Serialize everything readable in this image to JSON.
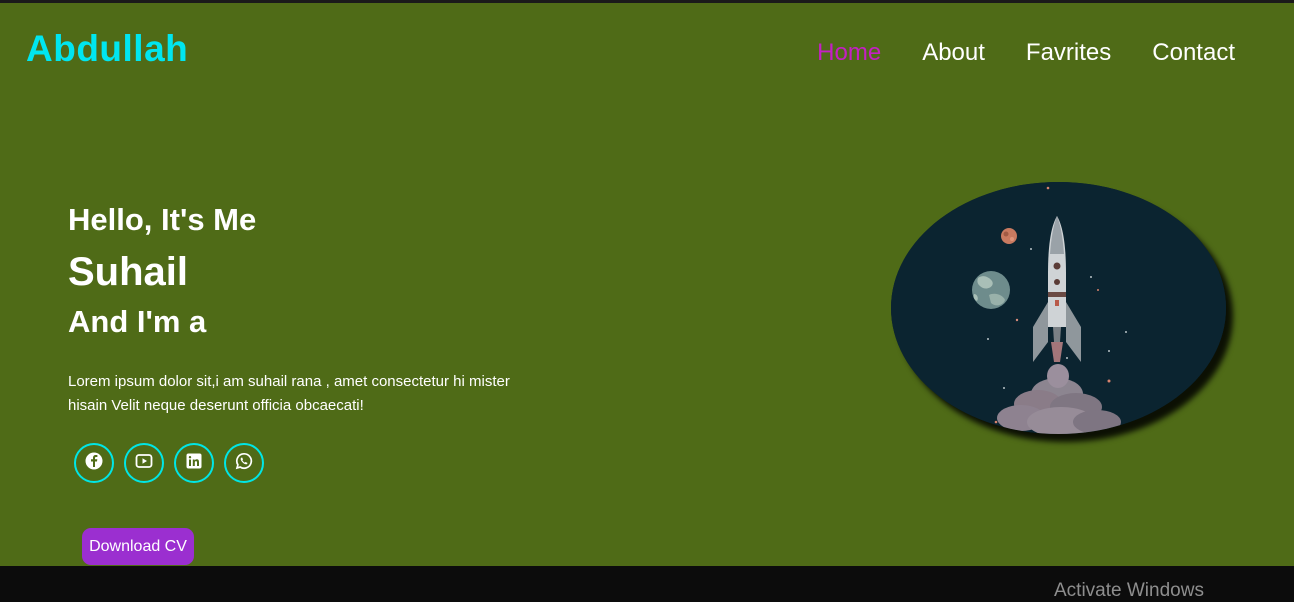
{
  "header": {
    "logo": "Abdullah",
    "nav": [
      {
        "label": "Home",
        "active": true
      },
      {
        "label": "About",
        "active": false
      },
      {
        "label": "Favrites",
        "active": false
      },
      {
        "label": "Contact",
        "active": false
      }
    ]
  },
  "hero": {
    "greeting": "Hello, It's Me",
    "name": "Suhail",
    "role": "And I'm a",
    "description": "Lorem ipsum dolor sit,i am suhail rana , amet consectetur hi mister hisain Velit neque deserunt officia obcaecati!",
    "socials": [
      "facebook-icon",
      "youtube-icon",
      "linkedin-icon",
      "whatsapp-icon"
    ],
    "cv_button": "Download CV"
  },
  "os_overlay": {
    "activate": "Activate Windows"
  },
  "colors": {
    "background": "#4f6b17",
    "logo": "#00e6f0",
    "nav_active": "#c51fc4",
    "social_ring": "#00e6e6",
    "button": "#9b2fd0"
  }
}
